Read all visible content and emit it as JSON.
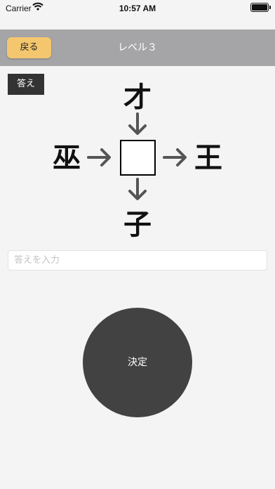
{
  "status_bar": {
    "carrier": "Carrier",
    "time": "10:57 AM"
  },
  "nav": {
    "back_label": "戻る",
    "title": "レベル３"
  },
  "answer_button_label": "答え",
  "puzzle": {
    "top": "才",
    "left": "巫",
    "right": "王",
    "bottom": "子",
    "blank": ""
  },
  "input": {
    "placeholder": "答えを入力",
    "value": ""
  },
  "submit_label": "決定",
  "colors": {
    "navbar": "#a5a5a7",
    "back_button": "#f4c76e",
    "submit_button": "#424242",
    "answer_button": "#333333",
    "arrow": "#555555"
  },
  "icons": [
    "wifi-icon",
    "battery-icon",
    "arrow-down-icon",
    "arrow-right-icon"
  ]
}
